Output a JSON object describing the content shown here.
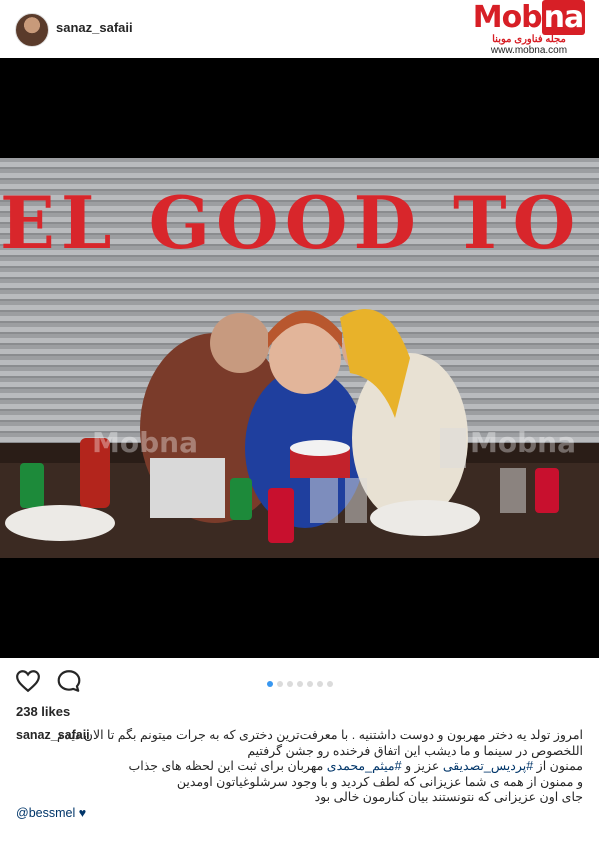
{
  "header": {
    "username": "sanaz_safaii",
    "logo": {
      "brand_prefix": "Mob",
      "brand_suffix": "na",
      "tagline": "مجله فناوری موبنا",
      "url": "www.mobna.com"
    }
  },
  "photo": {
    "shutter_text": "EL  GOOD  TO",
    "watermark_left": "Mobna",
    "watermark_right": "Mobna"
  },
  "actions": {
    "like_icon": "heart-outline-icon",
    "comment_icon": "speech-bubble-icon",
    "carousel_count": 7,
    "carousel_active_index": 0
  },
  "likes": "238 likes",
  "caption": {
    "username": "sanaz_safaii",
    "line1": "امروز تولد یه دختر مهربون و دوست داشتنیه . با معرفت‌ترین دختری که به جرات میتونم بگم تا الان دیدم",
    "line2": "اللخصوص در سینما و ما دیشب این اتفاق فرخنده رو جشن گرفتیم",
    "line3_a": "ممنون از",
    "line3_tag1": "#پردیس_تصدیقی",
    "line3_b": "عزیز و",
    "line3_tag2": "#میثم_محمدی",
    "line3_c": "مهربان برای ثبت این لحظه های جذاب",
    "line4": "و ممنون از همه ی شما عزیزانی که لطف کردید و با وجود سرشلوغیاتون اومدین",
    "line5": "جای اون عزیزانی که نتونستند بیان کنارمون خالی بود",
    "mention": "@bessmel",
    "mention_icon": "black-heart-icon"
  },
  "colors": {
    "accent_blue": "#3897f0",
    "brand_red": "#d71f26",
    "link": "#003569"
  }
}
